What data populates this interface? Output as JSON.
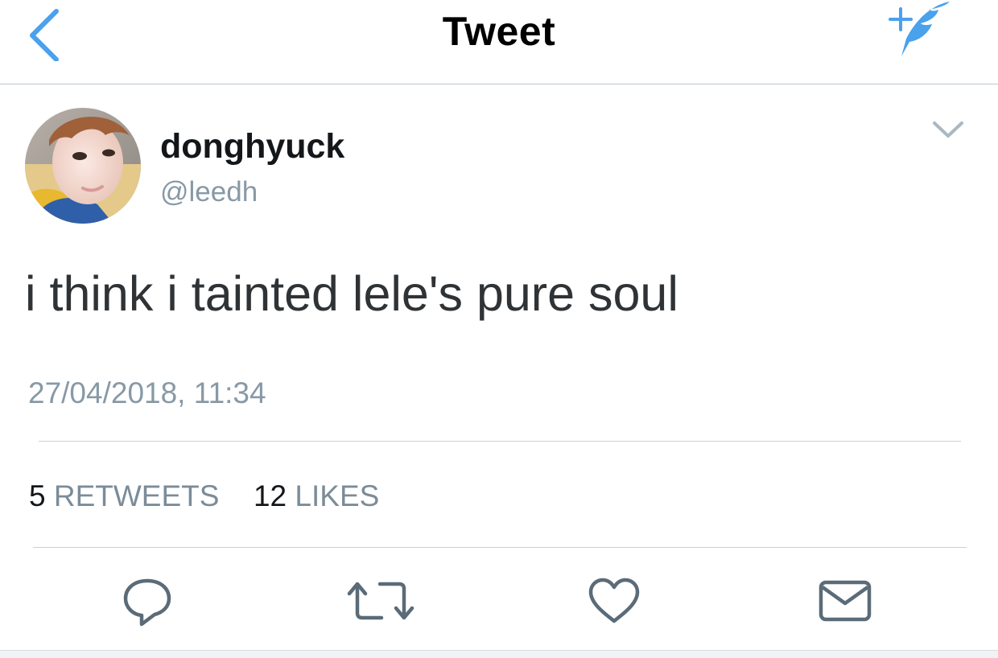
{
  "header": {
    "title": "Tweet",
    "back_icon": "back-chevron-icon",
    "compose_icon": "compose-feather-icon",
    "accent_color": "#4aa1ec"
  },
  "tweet": {
    "display_name": "donghyuck",
    "handle": "@leedh",
    "text": "i think i tainted lele's pure soul",
    "timestamp": "27/04/2018, 11:34",
    "avatar_icon": "profile-photo",
    "menu_icon": "chevron-down-icon"
  },
  "stats": {
    "retweets_count": "5",
    "retweets_label": "RETWEETS",
    "likes_count": "12",
    "likes_label": "LIKES"
  },
  "actions": [
    {
      "icon": "reply-icon"
    },
    {
      "icon": "retweet-icon"
    },
    {
      "icon": "like-heart-icon"
    },
    {
      "icon": "direct-message-icon"
    }
  ],
  "colors": {
    "icon_gray": "#5b6b78",
    "secondary_text": "#8899a6",
    "divider": "#c9d2d9"
  }
}
